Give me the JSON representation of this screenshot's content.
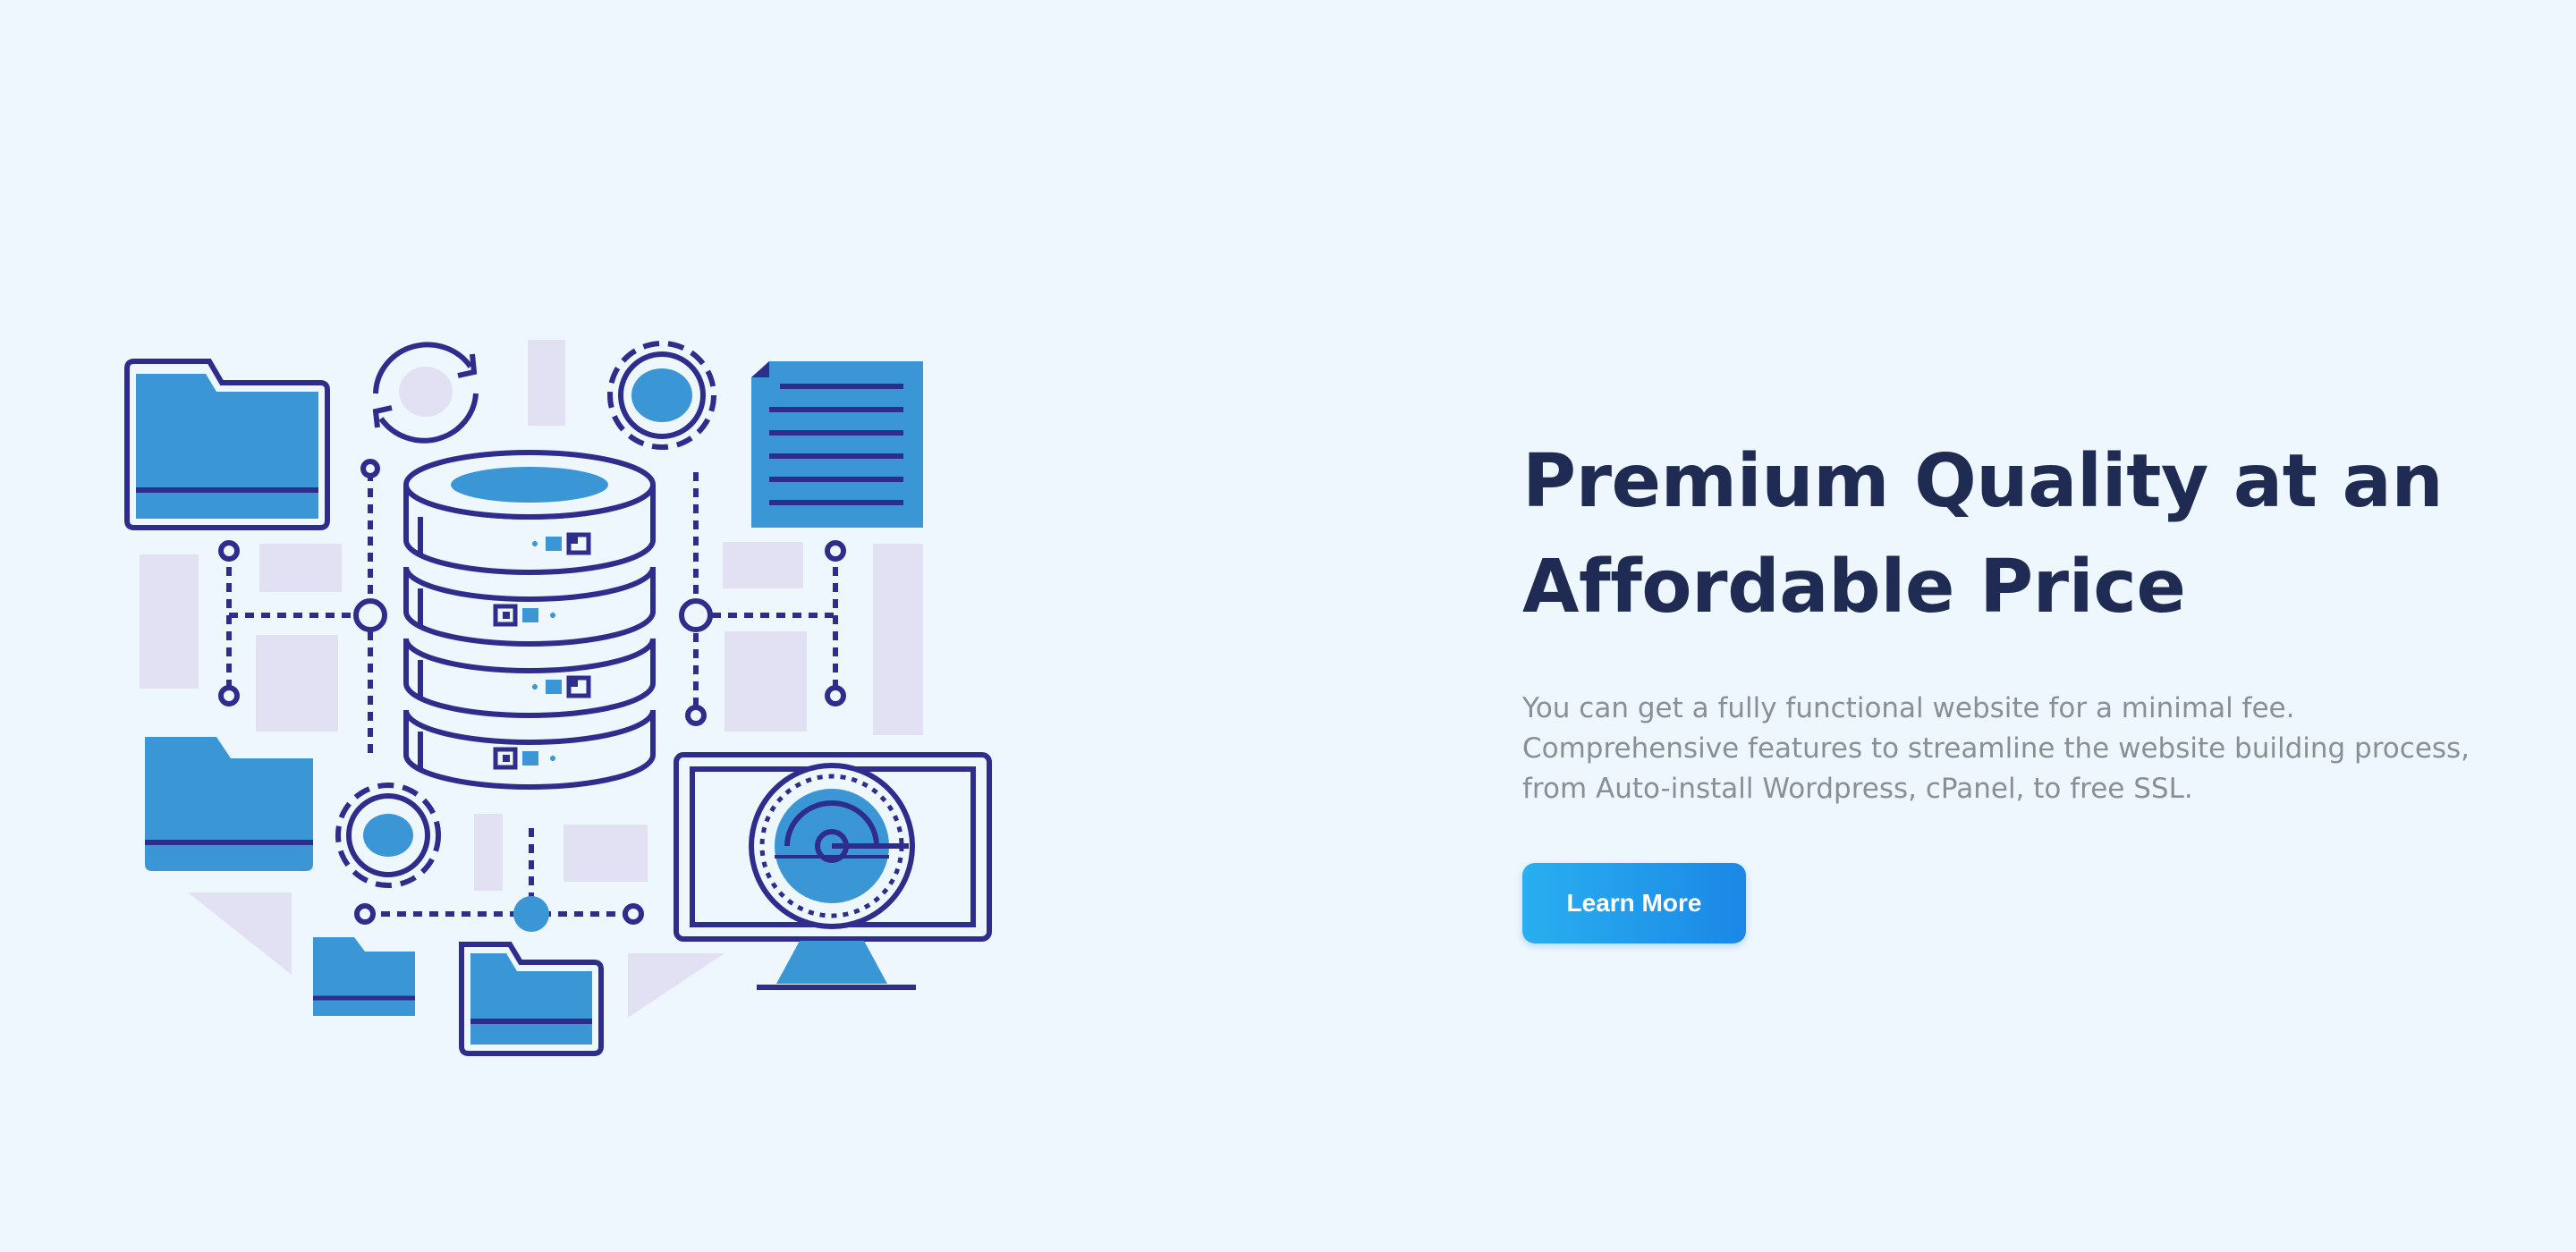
{
  "hero": {
    "headline_line1": "Premium Quality at an",
    "headline_line2": "Affordable Price",
    "description_line1": "You can get a fully functional website for a minimal fee.",
    "description_line2": "Comprehensive features to streamline the website building process,",
    "description_line3": "from Auto-install Wordpress, cPanel, to free SSL.",
    "cta_label": "Learn More"
  },
  "illustration": {
    "subject": "database-server-illustration",
    "icons": [
      "folder-icon",
      "sync-icon",
      "gear-icon",
      "document-icon",
      "database-icon",
      "monitor-icon",
      "speedometer-icon"
    ]
  },
  "colors": {
    "background": "#eef7fd",
    "headline": "#1f2b52",
    "description": "#8a8f96",
    "accent_blue": "#3b96d6",
    "outline_navy": "#2e2d8c",
    "placeholder_lavender": "#e2e1f3",
    "button_gradient_start": "#29aff0",
    "button_gradient_end": "#1b87e6"
  }
}
